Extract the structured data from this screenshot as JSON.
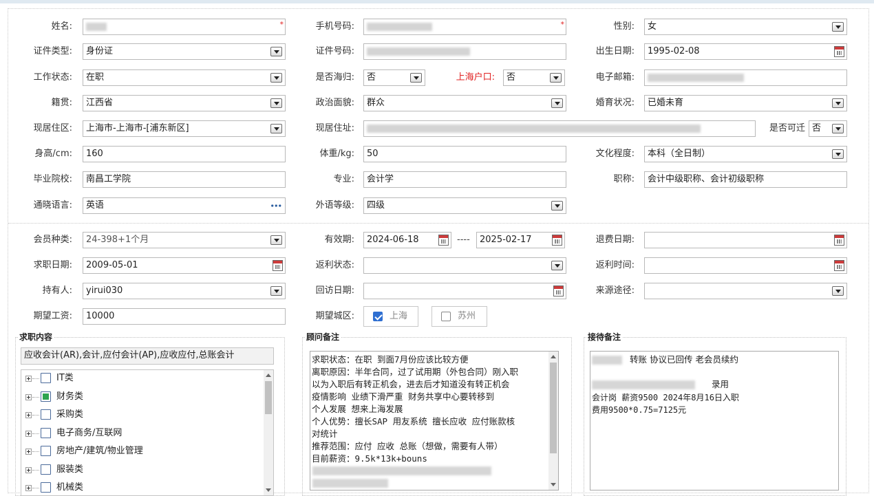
{
  "row1": {
    "name_label": "姓名:",
    "phone_label": "手机号码:",
    "gender_label": "性别:",
    "gender_value": "女"
  },
  "row2": {
    "id_type_label": "证件类型:",
    "id_type_value": "身份证",
    "id_no_label": "证件号码:",
    "birth_label": "出生日期:",
    "birth_value": "1995-02-08"
  },
  "row3": {
    "work_status_label": "工作状态:",
    "work_status_value": "在职",
    "overseas_label": "是否海归:",
    "overseas_value": "否",
    "hukou_label": "上海户口:",
    "hukou_value": "否",
    "email_label": "电子邮箱:"
  },
  "row4": {
    "native_label": "籍贯:",
    "native_value": "江西省",
    "political_label": "政治面貌:",
    "political_value": "群众",
    "marital_label": "婚育状况:",
    "marital_value": "已婚未育"
  },
  "row5": {
    "residence_area_label": "现居住区:",
    "residence_area_value": "上海市-上海市-[浦东新区]",
    "address_label": "现居住址:",
    "rent_label": "是否可迁",
    "rent_value": "否"
  },
  "row6": {
    "height_label": "身高/cm:",
    "height_value": "160",
    "weight_label": "体重/kg:",
    "weight_value": "50",
    "education_label": "文化程度:",
    "education_value": "本科（全日制）"
  },
  "row7": {
    "school_label": "毕业院校:",
    "school_value": "南昌工学院",
    "major_label": "专业:",
    "major_value": "会计学",
    "title_label": "职称:",
    "title_value": "会计中级职称、会计初级职称"
  },
  "row8": {
    "language_label": "通晓语言:",
    "language_value": "英语",
    "lang_level_label": "外语等级:",
    "lang_level_value": "四级"
  },
  "row9": {
    "member_type_label": "会员种类:",
    "member_type_value": "24-398+1个月",
    "valid_label": "有效期:",
    "valid_from": "2024-06-18",
    "valid_sep": "----",
    "valid_to": "2025-02-17",
    "refund_date_label": "退费日期:"
  },
  "row10": {
    "job_date_label": "求职日期:",
    "job_date_value": "2009-05-01",
    "rebate_status_label": "返利状态:",
    "rebate_time_label": "返利时间:"
  },
  "row11": {
    "holder_label": "持有人:",
    "holder_value": "yirui030",
    "revisit_label": "回访日期:",
    "source_label": "来源途径:"
  },
  "row12": {
    "salary_label": "期望工资:",
    "salary_value": "10000",
    "city_label": "期望城区:",
    "city_options": [
      {
        "label": "上海",
        "checked": true
      },
      {
        "label": "苏州",
        "checked": false
      }
    ]
  },
  "job_content": {
    "legend": "求职内容",
    "summary": "应收会计(AR),会计,应付会计(AP),应收应付,总账会计",
    "tree": [
      {
        "label": "IT类",
        "state": "none"
      },
      {
        "label": "财务类",
        "state": "partial"
      },
      {
        "label": "采购类",
        "state": "none"
      },
      {
        "label": "电子商务/互联网",
        "state": "none"
      },
      {
        "label": "房地产/建筑/物业管理",
        "state": "none"
      },
      {
        "label": "服装类",
        "state": "none"
      },
      {
        "label": "机械类",
        "state": "none"
      }
    ]
  },
  "advisor_notes": {
    "legend": "顾问备注",
    "lines": [
      "求职状态：在职 到面7月份应该比较方便",
      "离职原因：半年合同，过了试用期（外包合同）刚入职",
      "以为入职后有转正机会，进去后才知道没有转正机会",
      "疫情影响 业绩下滑严重 财务共享中心要转移到",
      "个人发展 想来上海发展",
      "个人优势：擅长SAP 用友系统  擅长应收 应付账款核",
      "对统计",
      "推荐范围：应付 应收 总账（想做，需要有人带）",
      "目前薪资：9.5k*13k+bouns"
    ]
  },
  "reception_notes": {
    "legend": "接待备注",
    "line1": "转账 协议已回传   老会员续约",
    "line2": "录用",
    "line3": "会计岗 薪资9500   2024年8月16日入职",
    "line4": "费用9500*0.75=7125元"
  }
}
